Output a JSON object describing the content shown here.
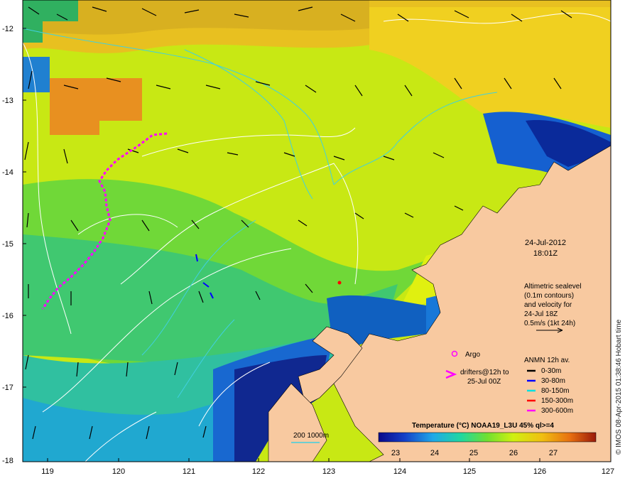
{
  "map": {
    "x_ticks": [
      "119",
      "120",
      "121",
      "122",
      "123",
      "124",
      "125",
      "126",
      "127"
    ],
    "y_ticks": [
      "-12",
      "-13",
      "-14",
      "-15",
      "-16",
      "-17",
      "-18"
    ],
    "date": "24-Jul-2012",
    "time": "18:01Z",
    "altimetry_note": [
      "Altimetric sealevel",
      "(0.1m contours)",
      "and velocity for",
      "24-Jul 18Z",
      "0.5m/s (1kt 24h)"
    ],
    "argo_label": "Argo",
    "drifters_label": [
      "drifters@12h to",
      "25-Jul 00Z"
    ],
    "anmn_title": "ANMN 12h av.",
    "anmn_legend": [
      {
        "label": "0-30m",
        "color": "#000000"
      },
      {
        "label": "30-80m",
        "color": "#0000ff"
      },
      {
        "label": "80-150m",
        "color": "#00e0e0"
      },
      {
        "label": "150-300m",
        "color": "#ff0000"
      },
      {
        "label": "300-600m",
        "color": "#ff00ff"
      }
    ],
    "bathymetry_label": "200 1000m",
    "colorbar_title": "Temperature (°C) NOAA19_L3U 45% ql>=4",
    "colorbar_ticks": [
      "23",
      "24",
      "25",
      "26",
      "27"
    ],
    "credit": "© IMOS 08-Apr-2015 01:38:46 Hobart time",
    "colors": {
      "land": "#f8c9a0",
      "drifter": "#ff00ff",
      "contour": "#ffffff",
      "bathy": "#40d0e0"
    }
  }
}
